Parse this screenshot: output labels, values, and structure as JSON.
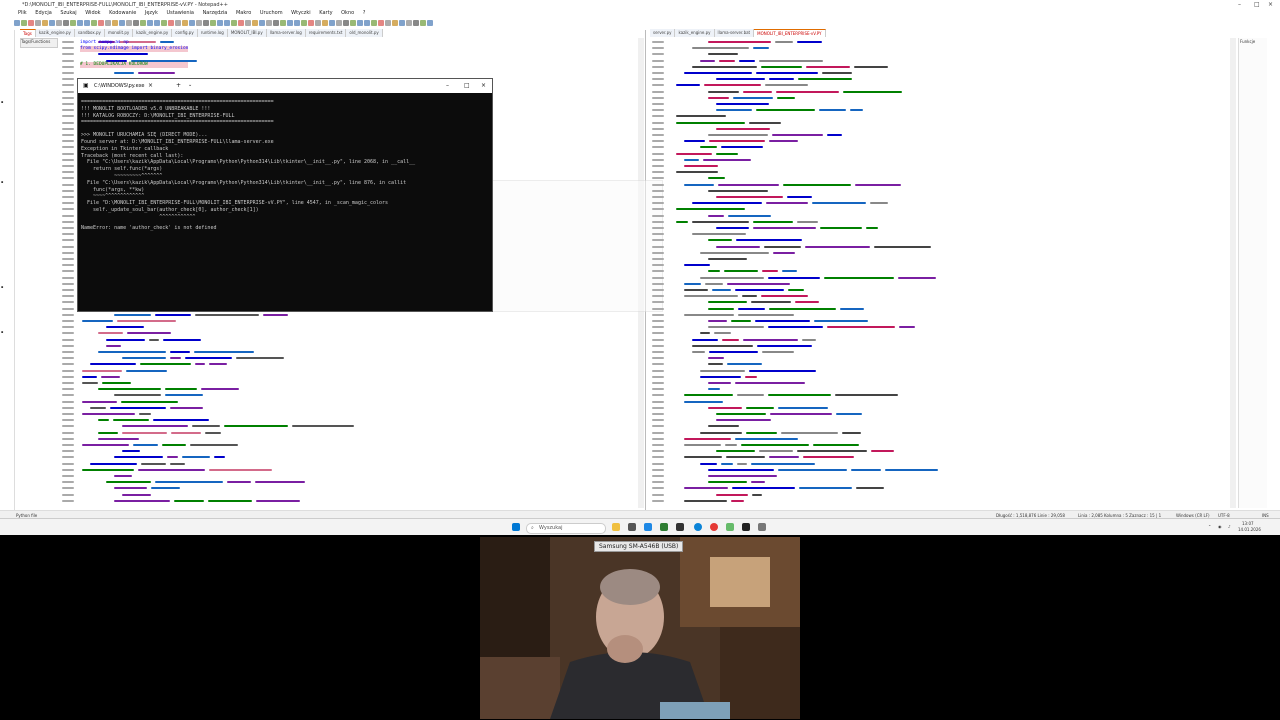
{
  "app": {
    "window_title": "*D:\\MONOLIT_IBI_ENTERPRISE-FULL\\MONOLIT_IBI_ENTERPRISE-vV.PY - Notepad++",
    "menu": [
      "Plik",
      "Edycja",
      "Szukaj",
      "Widok",
      "Kodowanie",
      "Język",
      "Ustawienia",
      "Narzędzia",
      "Makro",
      "Uruchom",
      "Wtyczki",
      "Karty",
      "Okno",
      "?"
    ],
    "left_tabs": [
      "Tags",
      "kazik_engine.py",
      "sandbox.py",
      "monolit.py",
      "kazik_engine.py",
      "config.py",
      "runtime.log",
      "MONOLIT_IBI.py",
      "llama-server.log",
      "requirements.txt",
      "old_monolit.py"
    ],
    "right_tabs": [
      "server.py",
      "kazik_engine.py",
      "llama-server.bat",
      "MONOLIT_IBI_ENTERPRISE-vV.PY"
    ],
    "panel_label": "Tags/Functions",
    "right_panel_label": "Funkcje"
  },
  "terminal": {
    "tab_title": "C:\\WINDOWS\\py.exe",
    "lines": [
      "================================================================",
      "!!! MONOLIT BOOTLOADER v5.0 UNBREAKABLE !!!",
      "!!! KATALOG ROBOCZY: D:\\MONOLIT_IBI_ENTERPRISE-FULL",
      "================================================================",
      ">>> MONOLIT URUCHAMIA SIĘ (DIRECT MODE)...",
      "Found server at: D:\\MONOLIT_IBI_ENTERPRISE-FULL\\llama-server.exe",
      "Exception in Tkinter callback",
      "Traceback (most recent call last):",
      "  File \"C:\\Users\\kazik\\AppData\\Local\\Programs\\Python\\Python314\\Lib\\tkinter\\__init__.py\", line 2068, in __call__",
      "    return self.func(*args)",
      "           ~~~~~~~~~^^^^^^^",
      "  File \"C:\\Users\\kazik\\AppData\\Local\\Programs\\Python\\Python314\\Lib\\tkinter\\__init__.py\", line 876, in callit",
      "    func(*args, **kw)",
      "    ~~~~^^^^^^^^^^^^^",
      "  File \"D:\\MONOLIT_IBI_ENTERPRISE-FULL\\MONOLIT_IBI_ENTERPRISE-vV.PY\", line 4547, in _scan_magic_colors",
      "    self._update_soul_bar(author_check[0], author_check[1])",
      "                          ^^^^^^^^^^^^",
      "NameError: name 'author_check' is not defined"
    ]
  },
  "code_left_top": [
    "import numpy as np",
    "from scipy.ndimage import binary_erosion",
    "",
    "# 1. DEDUPLIKACJA KOLORÓW"
  ],
  "code_right": [
    "else:",
    "return \"MAGIC: OK cleaned.\"",
    "except Exception as e:",
    "return f\"ERROR: {e}\"",
    "",
    "\"\"\"SWAP SYSTEM SIDE\"\"\"",
    "",
    "class SwapManager:",
    "def __init__(self, config, log_callback):",
    "self.cfg = config",
    "self.log = log_callback",
    "self.swap_path = self.cfg.swap_path"
  ],
  "statusbar": {
    "left": "Python file",
    "length": "Długość : 1,518,876   Linie : 29,058",
    "position": "Linia : 2,085   Kolumna : 5   Zaznacz : 15 | 1",
    "eol": "Windows (CR LF)",
    "encoding": "UTF-8",
    "mode": "INS"
  },
  "taskbar": {
    "search_placeholder": "Wyszukaj",
    "time": "13:07",
    "date": "14.01.2026"
  },
  "webcam": {
    "device_label": "Samsung SM-A546B (USB)"
  },
  "colors": {
    "accent": "#e06c00",
    "editor_bg": "#ffffff",
    "keyword": "#0000ff",
    "string": "#808080",
    "highlight": "#f4c7cf",
    "terminal_bg": "#0c0c0c"
  }
}
